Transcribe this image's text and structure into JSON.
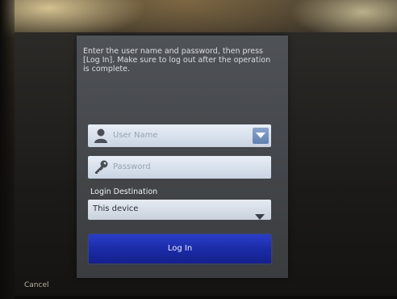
{
  "dialog": {
    "instructions": "Enter the user name and password, then press [Log In]. Make sure to log out after the operation is complete.",
    "username": {
      "placeholder": "User Name",
      "icon": "user-icon"
    },
    "password": {
      "placeholder": "Password",
      "icon": "key-icon"
    },
    "destination": {
      "label": "Login Destination",
      "selected": "This device"
    },
    "login_button": "Log In"
  },
  "footer": {
    "cancel_label": "Cancel"
  },
  "colors": {
    "login_button": "#1f32b8",
    "dialog_bg": "#45484c",
    "field_bg": "#dbe3ee"
  }
}
